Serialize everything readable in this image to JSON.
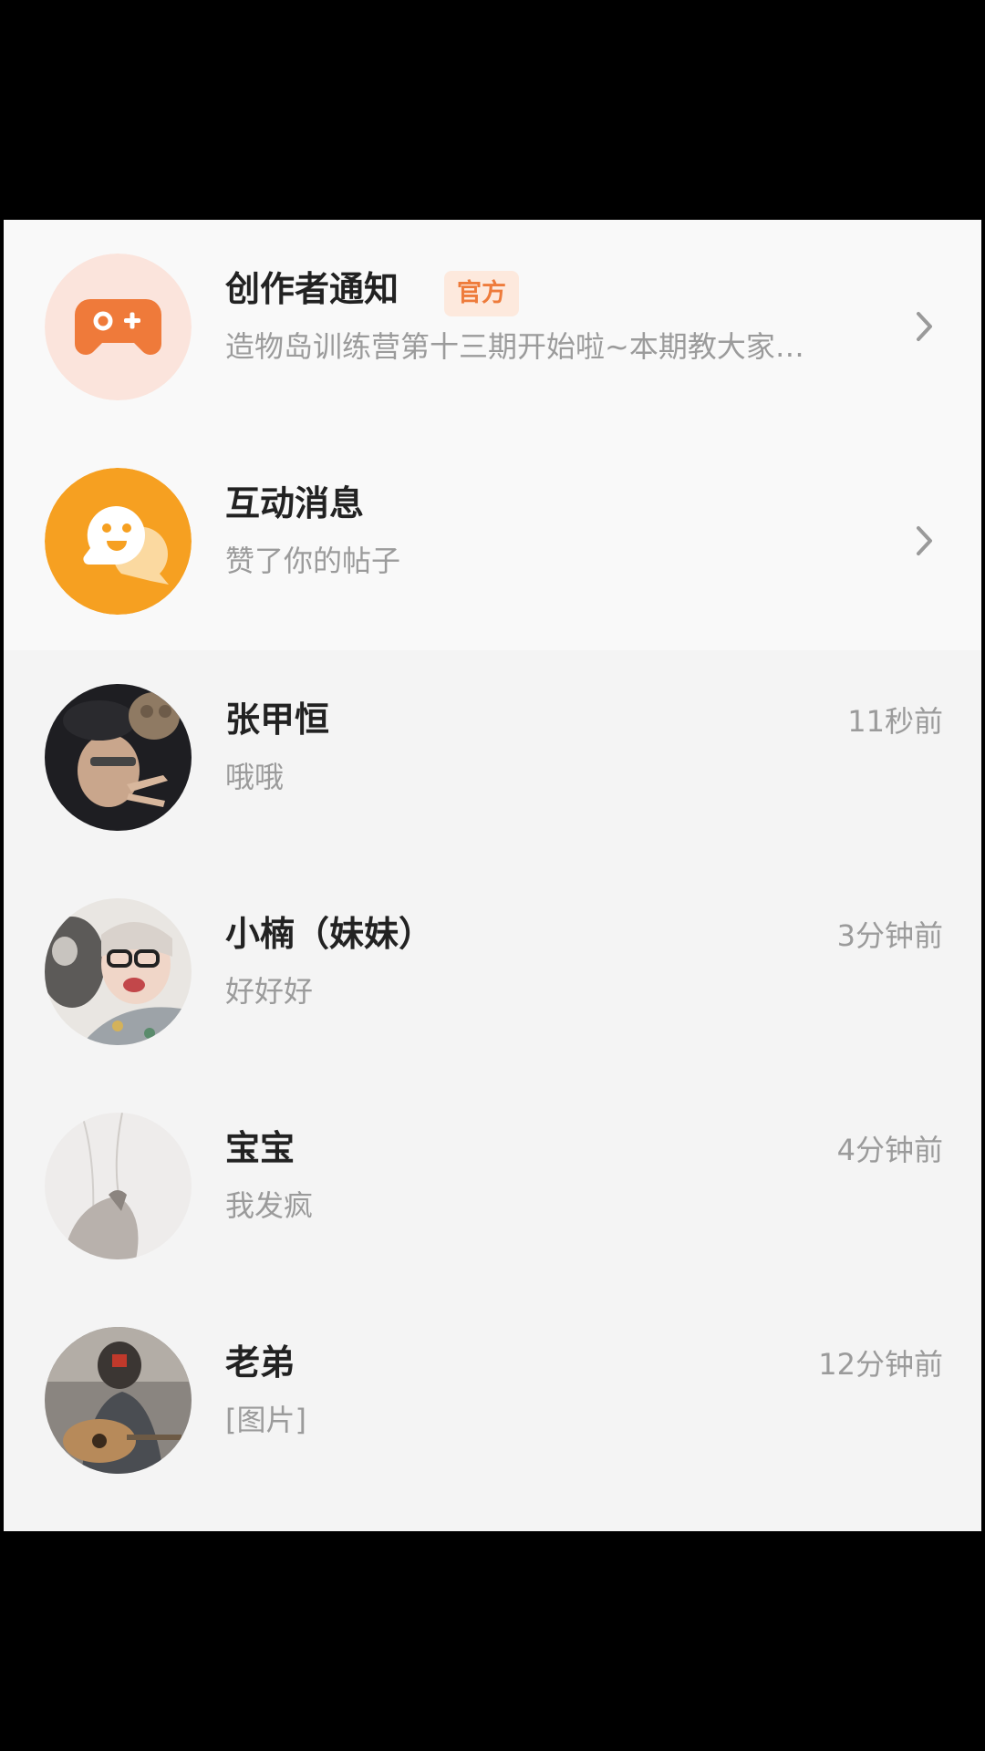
{
  "colors": {
    "accent": "#ee7b3b",
    "official_badge_bg": "#fde9dd",
    "creator_icon_bg": "#fbe4dc",
    "interaction_icon": "#f6a021",
    "title_text": "#222222",
    "secondary_text": "#9b9b9b"
  },
  "system_items": [
    {
      "title": "创作者通知",
      "badge": "官方",
      "preview": "造物岛训练营第十三期开始啦~本期教大家…",
      "icon": "gamepad-icon"
    },
    {
      "title": "互动消息",
      "preview": "赞了你的帖子",
      "icon": "chat-bubble-face-icon"
    }
  ],
  "conversations": [
    {
      "name": "张甲恒",
      "last_message": "哦哦",
      "time": "11秒前"
    },
    {
      "name": "小楠（妹妹）",
      "last_message": "好好好",
      "time": "3分钟前"
    },
    {
      "name": "宝宝",
      "last_message": "我发疯",
      "time": "4分钟前"
    },
    {
      "name": "老弟",
      "last_message": "[图片]",
      "time": "12分钟前"
    }
  ]
}
